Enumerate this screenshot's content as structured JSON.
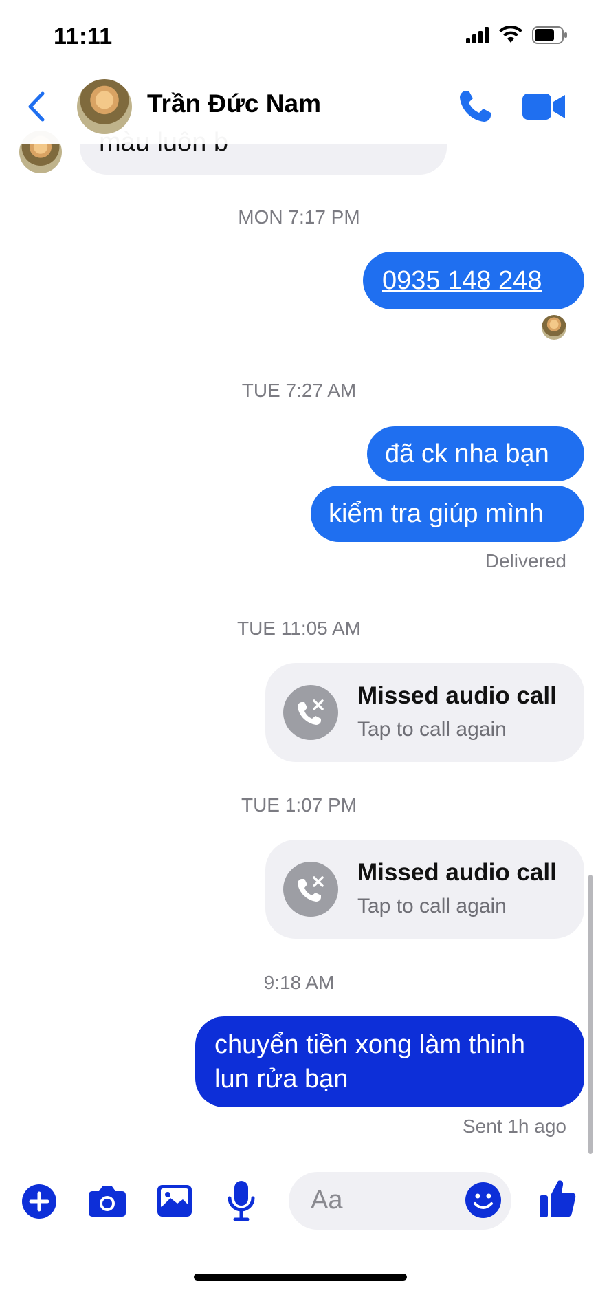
{
  "status_bar": {
    "time": "11:11"
  },
  "header": {
    "contact_name": "Trần Đức Nam"
  },
  "messages": {
    "incoming_partial": "màu luôn b",
    "ts1": "MON 7:17 PM",
    "phone_message": "0935 148 248",
    "ts2": "TUE 7:27 AM",
    "msg_transfer": "đã ck nha bạn",
    "msg_check": "kiểm tra giúp mình",
    "delivered": "Delivered",
    "ts3": "TUE 11:05 AM",
    "call1": {
      "title": "Missed audio call",
      "subtitle": "Tap to call again"
    },
    "ts4": "TUE 1:07 PM",
    "call2": {
      "title": "Missed audio call",
      "subtitle": "Tap to call again"
    },
    "ts5": "9:18 AM",
    "last_message_line1": "chuyển tiền xong làm thinh",
    "last_message_line2": "lun rửa bạn",
    "sent_status": "Sent 1h ago"
  },
  "composer": {
    "placeholder": "Aa"
  },
  "colors": {
    "accent": "#1f6ff0",
    "deep_blue": "#0d2fd8",
    "bubble_gray": "#f0f0f4"
  },
  "icons": [
    "back-chevron-icon",
    "phone-icon",
    "video-camera-icon",
    "plus-icon",
    "camera-icon",
    "gallery-icon",
    "microphone-icon",
    "emoji-icon",
    "like-icon",
    "missed-call-icon"
  ]
}
